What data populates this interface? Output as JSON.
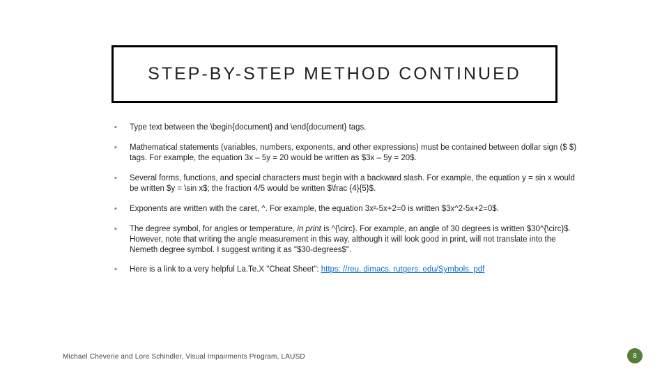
{
  "title": "STEP-BY-STEP METHOD CONTINUED",
  "bullets": [
    {
      "text": "Type text between the \\begin{document} and \\end{document} tags."
    },
    {
      "text": "Mathematical statements (variables, numbers, exponents, and other expressions) must be contained between dollar sign ($ $) tags. For example, the equation 3x – 5y = 20 would be written as $3x – 5y = 20$."
    },
    {
      "text": "Several forms, functions, and special characters must begin with a backward slash. For example, the equation y = sin x would be written $y = \\sin x$; the fraction 4/5 would be written $\\frac {4}{5}$."
    },
    {
      "text": "Exponents are written with the caret, ^. For example, the equation 3x²-5x+2=0 is written $3x^2-5x+2=0$."
    },
    {
      "prefix": "The degree symbol, for angles or temperature, ",
      "italic": "in print",
      "suffix": " is ^{\\circ}. For example, an angle of 30 degrees is written $30^{\\circ}$. However, note that writing the angle measurement in this way, although it will look good in print, will not translate into the Nemeth degree symbol. I suggest writing it as \"$30-degrees$\"."
    },
    {
      "prefix": "Here is a link to a very helpful La.Te.X \"Cheat Sheet\": ",
      "link_text": "https: //reu. dimacs. rutgers. edu/Symbols. pdf"
    }
  ],
  "footer": "Michael Cheverie and Lore Schindler, Visual Impairments Program, LAUSD",
  "page_number": "8",
  "colors": {
    "page_badge": "#567e3a",
    "link": "#0b6cd1"
  }
}
